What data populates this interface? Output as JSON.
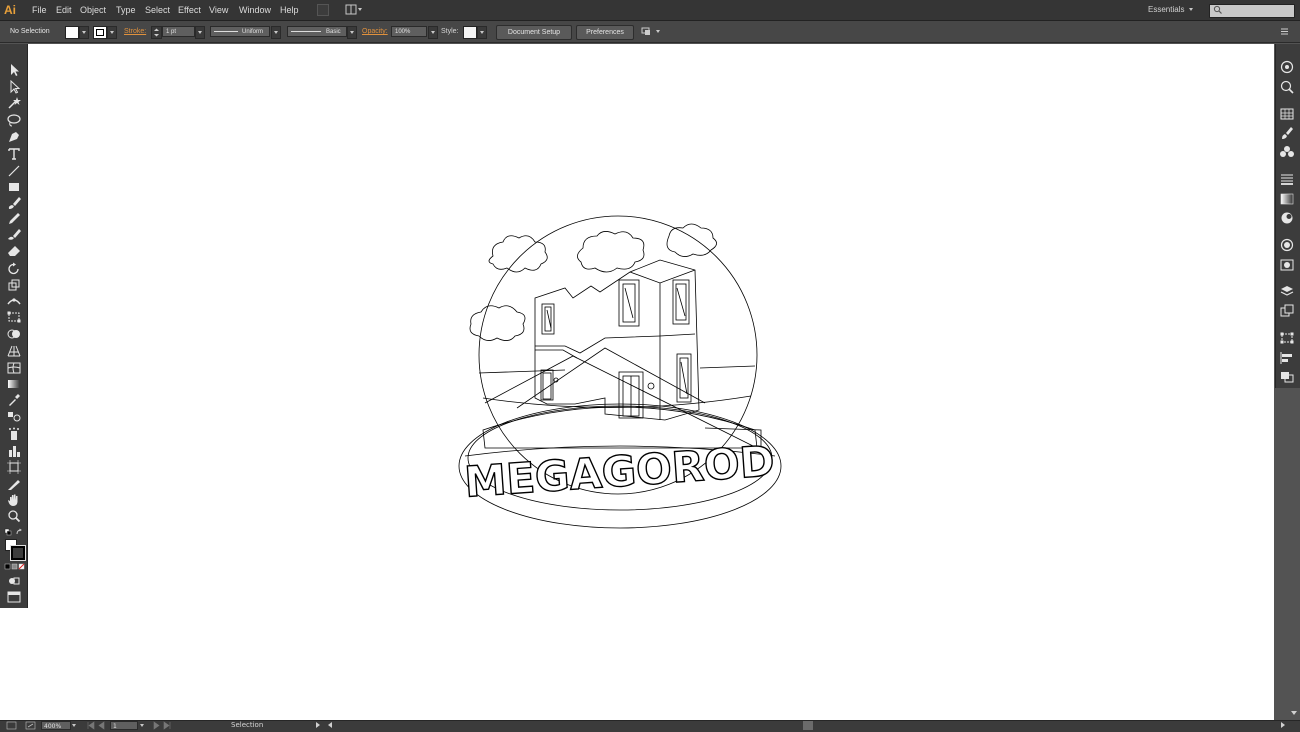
{
  "app": {
    "logo": "Ai"
  },
  "menu": [
    "File",
    "Edit",
    "Object",
    "Type",
    "Select",
    "Effect",
    "View",
    "Window",
    "Help"
  ],
  "workspace": {
    "label": "Essentials"
  },
  "control_bar": {
    "selection": "No Selection",
    "stroke_label": "Stroke:",
    "stroke_weight": "1 pt",
    "profile": "Uniform",
    "brush": "Basic",
    "opacity_label": "Opacity:",
    "opacity_value": "100%",
    "style_label": "Style:",
    "document_setup": "Document Setup",
    "preferences": "Preferences"
  },
  "status_bar": {
    "zoom": "400%",
    "artboard": "1",
    "tool": "Selection"
  },
  "artwork": {
    "text": "MEGAGOROD"
  },
  "colors": {
    "accent": "#e0913d",
    "chrome": "#535353",
    "panel": "#3c3c3c",
    "canvas": "#ffffff"
  }
}
